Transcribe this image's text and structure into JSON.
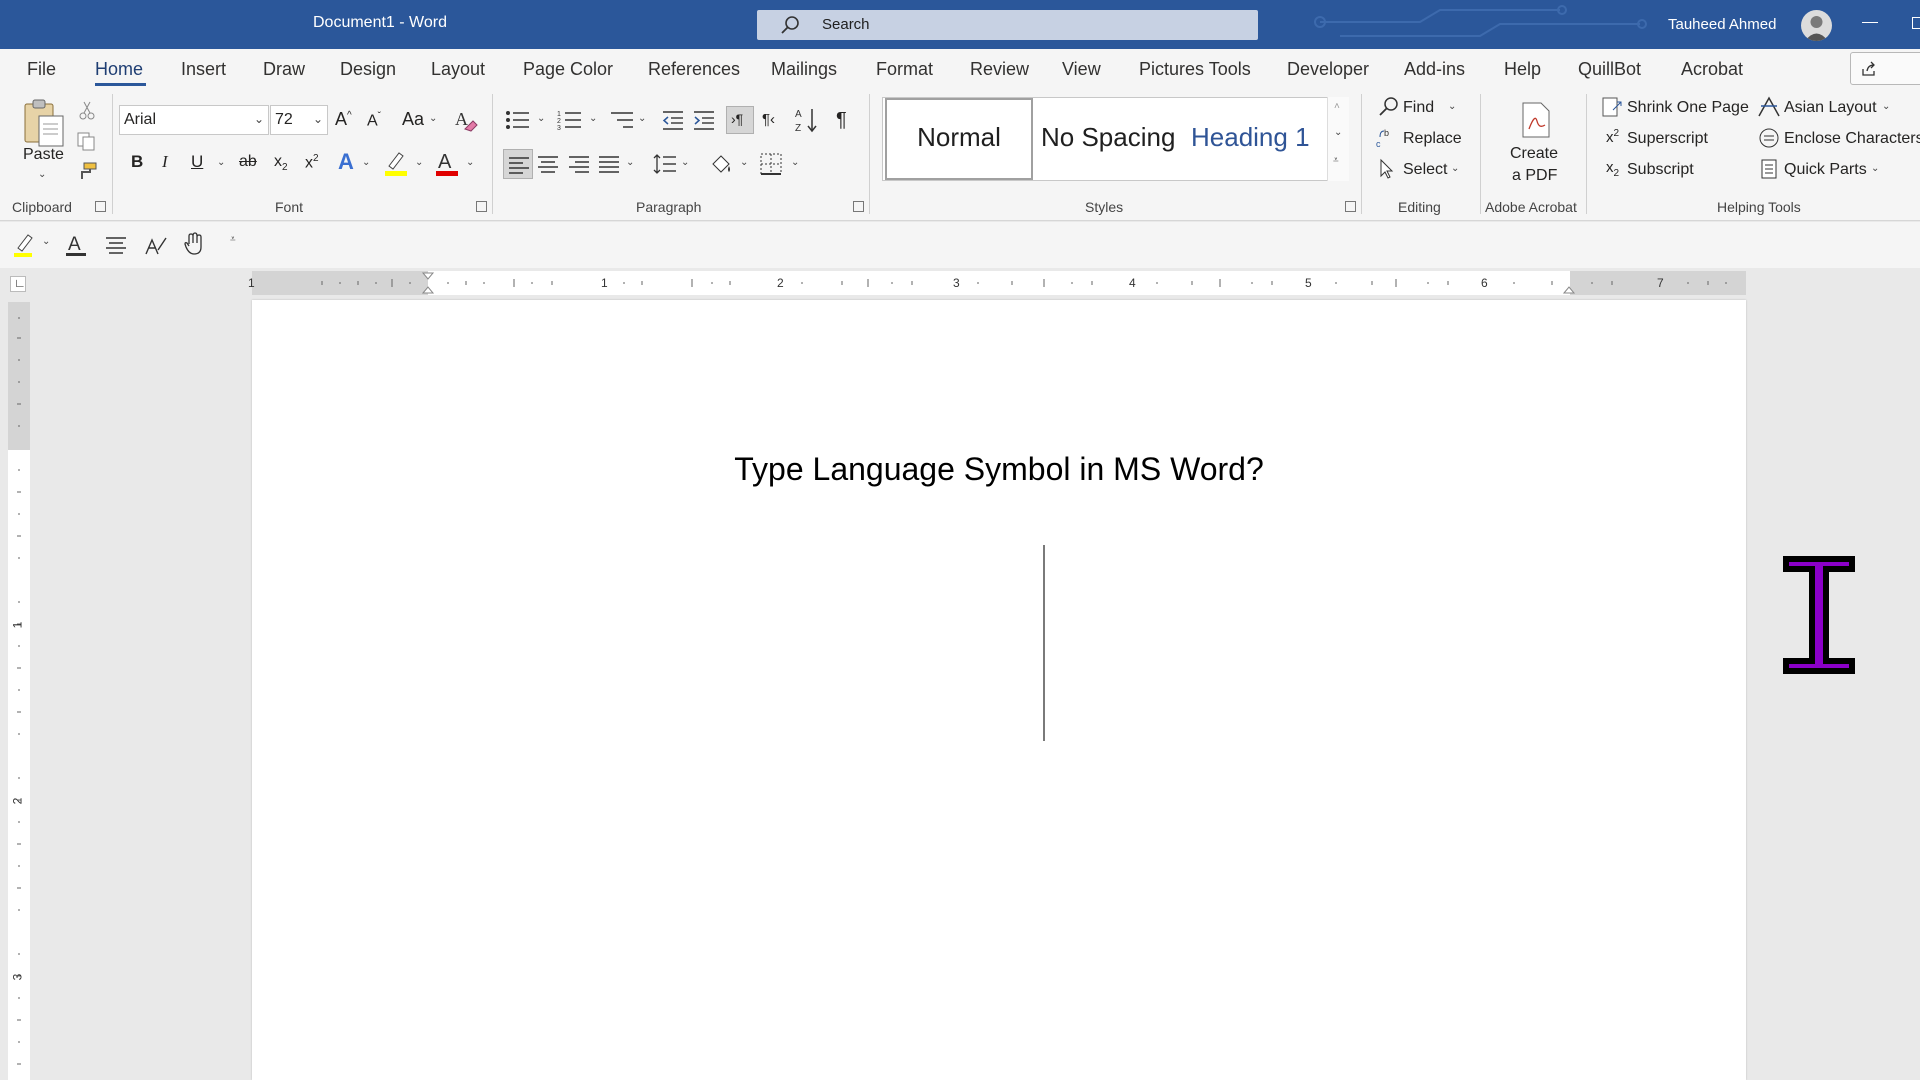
{
  "window": {
    "document_title": "Document1  -  Word",
    "search_placeholder": "Search",
    "user_name": "Tauheed Ahmed"
  },
  "tabs": [
    {
      "label": "File"
    },
    {
      "label": "Home"
    },
    {
      "label": "Insert"
    },
    {
      "label": "Draw"
    },
    {
      "label": "Design"
    },
    {
      "label": "Layout"
    },
    {
      "label": "Page Color"
    },
    {
      "label": "References"
    },
    {
      "label": "Mailings"
    },
    {
      "label": "Format"
    },
    {
      "label": "Review"
    },
    {
      "label": "View"
    },
    {
      "label": "Pictures Tools"
    },
    {
      "label": "Developer"
    },
    {
      "label": "Add-ins"
    },
    {
      "label": "Help"
    },
    {
      "label": "QuillBot"
    },
    {
      "label": "Acrobat"
    }
  ],
  "active_tab": "Home",
  "clipboard": {
    "paste_label": "Paste",
    "group_label": "Clipboard"
  },
  "font": {
    "font_name": "Arial",
    "font_size": "72",
    "change_case_label": "Aa",
    "bold": "B",
    "italic": "I",
    "underline": "U",
    "strike": "ab",
    "group_label": "Font"
  },
  "paragraph": {
    "group_label": "Paragraph"
  },
  "styles": {
    "items": [
      "Normal",
      "No Spacing",
      "Heading 1"
    ],
    "group_label": "Styles"
  },
  "editing": {
    "find": "Find",
    "replace": "Replace",
    "select": "Select",
    "group_label": "Editing"
  },
  "adobe": {
    "create_pdf_line1": "Create",
    "create_pdf_line2": "a PDF",
    "group_label": "Adobe Acrobat"
  },
  "helping_tools": {
    "shrink_one_page": "Shrink One Page",
    "superscript": "Superscript",
    "subscript": "Subscript",
    "asian_layout": "Asian Layout",
    "enclose_characters": "Enclose Characters",
    "quick_parts": "Quick Parts",
    "group_label": "Helping Tools"
  },
  "ruler": {
    "horizontal_numbers": [
      "1",
      "1",
      "2",
      "3",
      "4",
      "5",
      "6",
      "7"
    ],
    "vertical_numbers": [
      "1",
      "2",
      "3"
    ]
  },
  "document": {
    "heading": "Type Language Symbol in MS Word?"
  },
  "colors": {
    "title_bar": "#2b579a",
    "highlight": "#ffff00",
    "font_color": "#e00000",
    "cursor": "#8b00c9"
  }
}
